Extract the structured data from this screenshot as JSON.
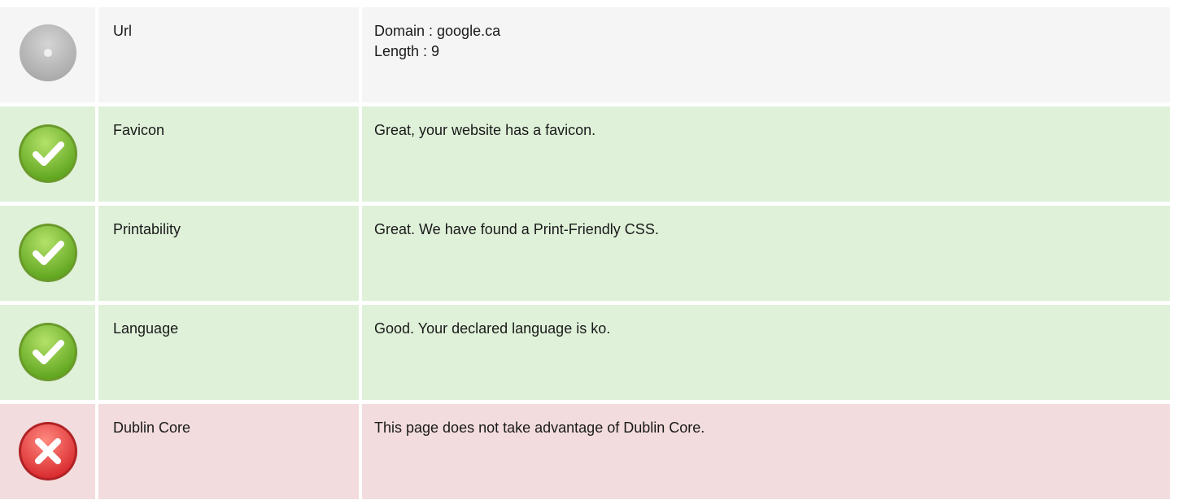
{
  "rows": [
    {
      "status": "neutral",
      "icon": "neutral-disc-icon",
      "label": "Url",
      "lines": [
        "Domain : google.ca",
        "Length : 9"
      ]
    },
    {
      "status": "pass",
      "icon": "green-check-icon",
      "label": "Favicon",
      "lines": [
        "Great, your website has a favicon."
      ]
    },
    {
      "status": "pass",
      "icon": "green-check-icon",
      "label": "Printability",
      "lines": [
        "Great. We have found a Print-Friendly CSS."
      ]
    },
    {
      "status": "pass",
      "icon": "green-check-icon",
      "label": "Language",
      "lines": [
        "Good. Your declared language is ko."
      ]
    },
    {
      "status": "fail",
      "icon": "red-cross-icon",
      "label": "Dublin Core",
      "lines": [
        "This page does not take advantage of Dublin Core."
      ]
    }
  ],
  "colors": {
    "pass_bg": "#dff1d9",
    "fail_bg": "#f2dcdd",
    "neutral_bg": "#f5f5f5",
    "pass_icon": "#7cc23a",
    "fail_icon": "#e0363a",
    "neutral_icon": "#b8b8b8"
  }
}
